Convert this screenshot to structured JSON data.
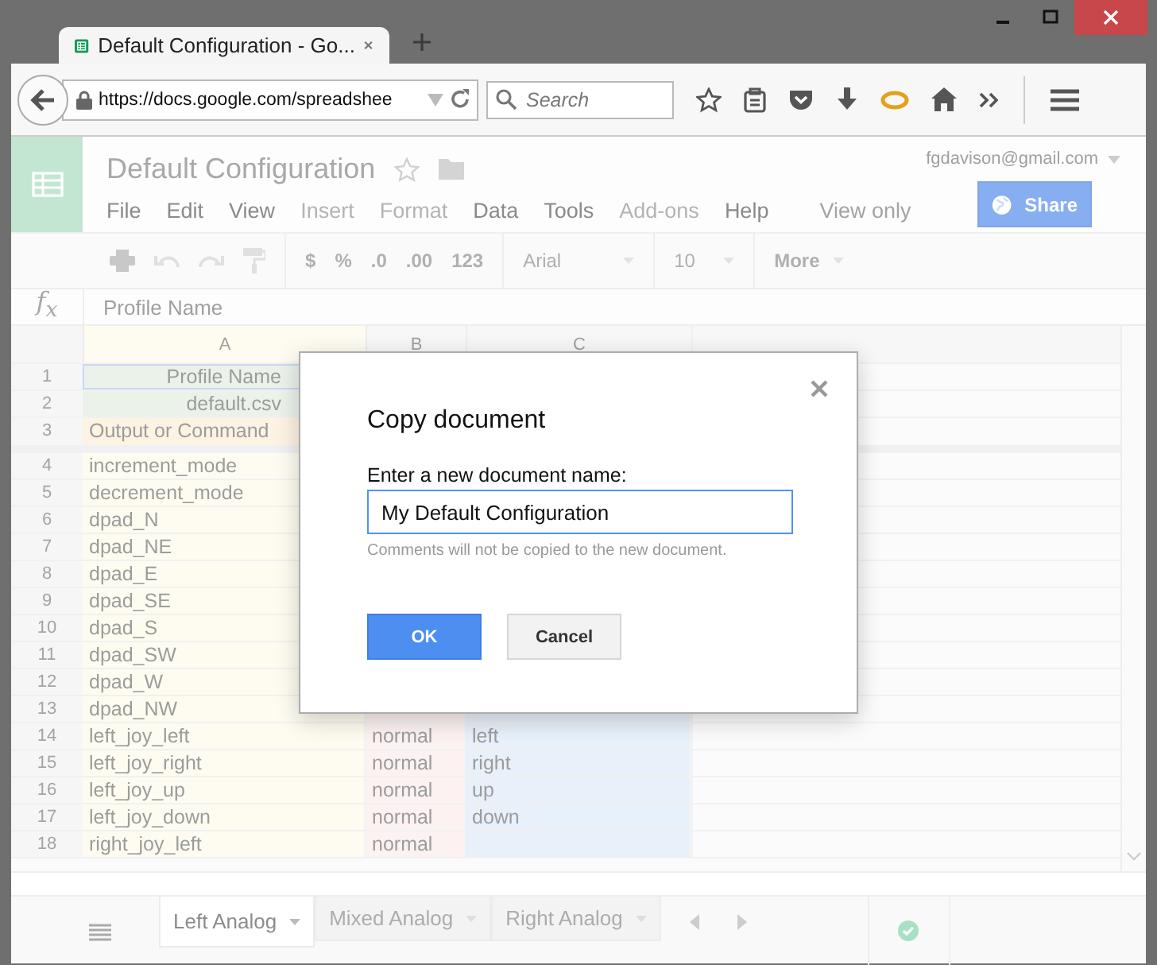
{
  "browser": {
    "tab_title": "Default Configuration - Go...",
    "url": "https://docs.google.com/spreadshee",
    "search": {
      "placeholder": "Search"
    }
  },
  "document": {
    "title": "Default Configuration",
    "account": "fgdavison@gmail.com",
    "mode": "View only",
    "share": "Share",
    "menu": [
      {
        "label": "File",
        "disabled": false
      },
      {
        "label": "Edit",
        "disabled": false
      },
      {
        "label": "View",
        "disabled": false
      },
      {
        "label": "Insert",
        "disabled": true
      },
      {
        "label": "Format",
        "disabled": true
      },
      {
        "label": "Data",
        "disabled": false
      },
      {
        "label": "Tools",
        "disabled": false
      },
      {
        "label": "Add-ons",
        "disabled": true
      },
      {
        "label": "Help",
        "disabled": false
      }
    ]
  },
  "toolbar": {
    "formats": [
      "$",
      "%",
      ".0",
      ".00",
      "123"
    ],
    "font": "Arial",
    "size": "10",
    "more": "More"
  },
  "formula_bar": {
    "label": "f$_{x}$",
    "value": "Profile Name"
  },
  "grid": {
    "columns": [
      "A",
      "B",
      "C"
    ],
    "rows": [
      {
        "number": "1",
        "kind": "header",
        "selected": true,
        "a": "Profile Name"
      },
      {
        "number": "2",
        "kind": "header",
        "selected": false,
        "a": "default.csv"
      },
      {
        "number": "3",
        "kind": "section",
        "selected": false,
        "a": "Output or Command"
      },
      {
        "number": "4",
        "kind": "data",
        "selected": false,
        "a": "increment_mode"
      },
      {
        "number": "5",
        "kind": "data",
        "selected": false,
        "a": "decrement_mode"
      },
      {
        "number": "6",
        "kind": "data",
        "selected": false,
        "a": "dpad_N"
      },
      {
        "number": "7",
        "kind": "data",
        "selected": false,
        "a": "dpad_NE"
      },
      {
        "number": "8",
        "kind": "data",
        "selected": false,
        "a": "dpad_E"
      },
      {
        "number": "9",
        "kind": "data",
        "selected": false,
        "a": "dpad_SE"
      },
      {
        "number": "10",
        "kind": "data",
        "selected": false,
        "a": "dpad_S"
      },
      {
        "number": "11",
        "kind": "data",
        "selected": false,
        "a": "dpad_SW"
      },
      {
        "number": "12",
        "kind": "data",
        "selected": false,
        "a": "dpad_W"
      },
      {
        "number": "13",
        "kind": "data",
        "selected": false,
        "a": "dpad_NW"
      },
      {
        "number": "14",
        "kind": "data",
        "selected": false,
        "a": "left_joy_left",
        "b": "normal",
        "c": "left"
      },
      {
        "number": "15",
        "kind": "data",
        "selected": false,
        "a": "left_joy_right",
        "b": "normal",
        "c": "right"
      },
      {
        "number": "16",
        "kind": "data",
        "selected": false,
        "a": "left_joy_up",
        "b": "normal",
        "c": "up"
      },
      {
        "number": "17",
        "kind": "data",
        "selected": false,
        "a": "left_joy_down",
        "b": "normal",
        "c": "down"
      },
      {
        "number": "18",
        "kind": "data",
        "selected": false,
        "a": "right_joy_left",
        "b": "normal"
      }
    ]
  },
  "dialog": {
    "title": "Copy document",
    "label": "Enter a new document name:",
    "value": "My Default Configuration",
    "hint": "Comments will not be copied to the new document.",
    "ok": "OK",
    "cancel": "Cancel"
  },
  "sheet_tabs": [
    {
      "label": "Left Analog",
      "selected": true
    },
    {
      "label": "Mixed Analog",
      "selected": false
    },
    {
      "label": "Right Analog",
      "selected": false
    }
  ]
}
